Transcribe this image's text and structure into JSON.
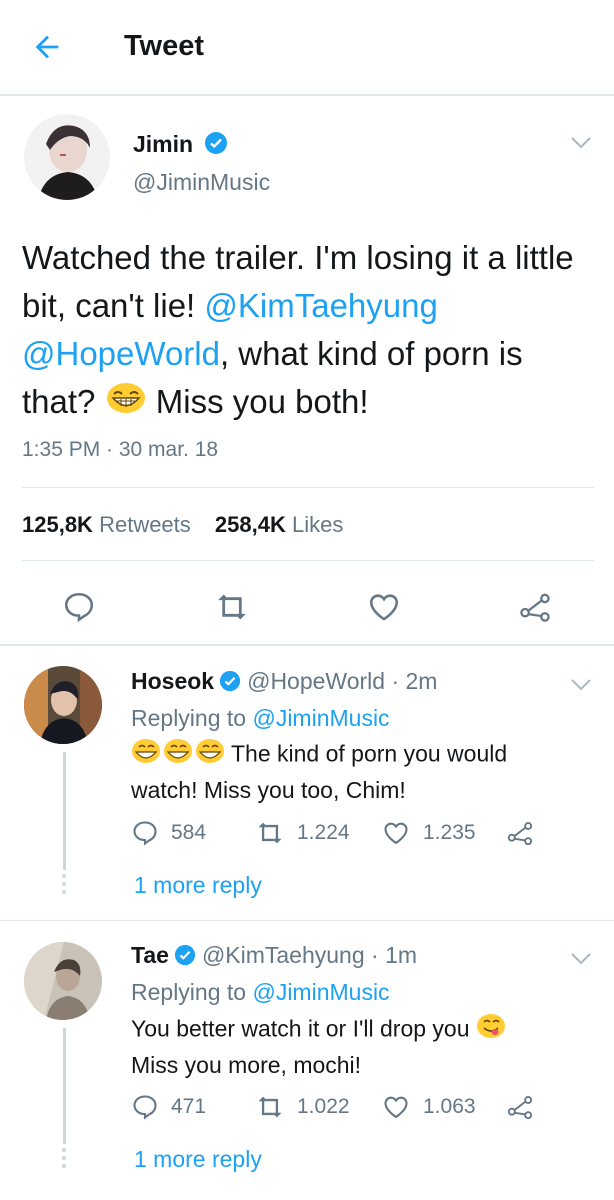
{
  "header": {
    "title": "Tweet"
  },
  "main_tweet": {
    "name": "Jimin",
    "handle": "@JiminMusic",
    "text_parts": [
      "Watched the trailer. I'm losing it a little bit, can't lie! ",
      "@KimTaehyung",
      "@HopeWorld",
      ", what kind of porn is that? ",
      " Miss you both!"
    ],
    "time": "1:35 PM · 30 mar. 18",
    "retweets_count": "125,8K",
    "retweets_label": "Retweets",
    "likes_count": "258,4K",
    "likes_label": "Likes"
  },
  "replies": [
    {
      "name": "Hoseok",
      "handle_time": "@HopeWorld · 2m",
      "replying_prefix": "Replying to ",
      "replying_to": "@JiminMusic",
      "text_line1": " The kind of porn you would",
      "text_line2": "watch! Miss you too, Chim!",
      "reply_count": "584",
      "retweet_count": "1.224",
      "like_count": "1.235",
      "more": "1 more reply"
    },
    {
      "name": "Tae",
      "handle_time": "@KimTaehyung · 1m",
      "replying_prefix": "Replying to ",
      "replying_to": "@JiminMusic",
      "text_line1": "You better watch it or I'll drop you ",
      "text_line2": "Miss you more, mochi!",
      "reply_count": "471",
      "retweet_count": "1.022",
      "like_count": "1.063",
      "more": "1 more reply"
    }
  ],
  "colors": {
    "accent": "#1da1f2",
    "secondary": "#657786",
    "text": "#14171a",
    "border": "#e1e8ed"
  },
  "icons": [
    "back-arrow-icon",
    "verified-icon",
    "chevron-down-icon",
    "reply-icon",
    "retweet-icon",
    "like-icon",
    "share-icon",
    "laughing-emoji",
    "yum-emoji"
  ]
}
